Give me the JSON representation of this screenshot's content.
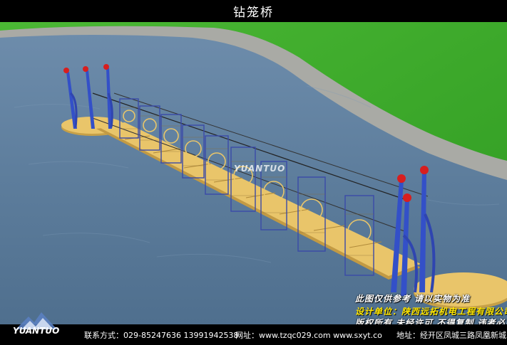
{
  "title": "钻笼桥",
  "watermark": "YUANTUO",
  "brand": {
    "logo_text": "YUANTUO"
  },
  "notes": [
    "此图仅供参考   请以实物为准",
    "设计单位：陕西远拓机电工程有限公司",
    "版权所有  未经许可  不得复制  违者必究"
  ],
  "footer": {
    "phone": "联系方式：029-85247636 13991942538",
    "website": "网址：www.tzqc029.com  www.sxyt.co",
    "address": "地址：经开区凤城三路凤凰新城"
  },
  "colors": {
    "water": "#5f7f9e",
    "grass": "#3fae2b",
    "deck": "#e9c56a",
    "posts": "#3350c8",
    "post_tops": "#d81e1e",
    "text_yellow": "#ffe600"
  },
  "icons": [
    "mountain-logo-icon"
  ]
}
